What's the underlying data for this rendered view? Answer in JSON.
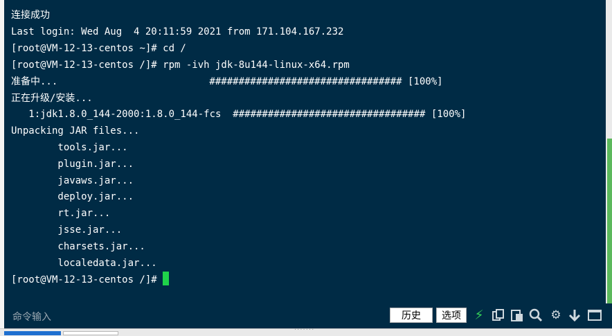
{
  "terminal": {
    "lines": [
      "连接成功",
      "Last login: Wed Aug  4 20:11:59 2021 from 171.104.167.232",
      "[root@VM-12-13-centos ~]# cd /",
      "[root@VM-12-13-centos /]# rpm -ivh jdk-8u144-linux-x64.rpm",
      "准备中...                          ################################# [100%]",
      "正在升级/安装...",
      "   1:jdk1.8.0_144-2000:1.8.0_144-fcs  ################################# [100%]",
      "Unpacking JAR files...",
      "        tools.jar...",
      "        plugin.jar...",
      "        javaws.jar...",
      "        deploy.jar...",
      "        rt.jar...",
      "        jsse.jar...",
      "        charsets.jar...",
      "        localedata.jar...",
      "[root@VM-12-13-centos /]#"
    ]
  },
  "bottom_bar": {
    "command_placeholder": "命令输入",
    "history_label": "历史",
    "options_label": "选项"
  },
  "icons": [
    "lightning-icon",
    "copy-icon",
    "paste-icon",
    "search-icon",
    "gear-icon",
    "download-icon",
    "window-icon"
  ],
  "colors": {
    "terminal_bg": "#002b45",
    "cursor": "#1fd34a",
    "scroll_thumb": "#5cb85c"
  }
}
